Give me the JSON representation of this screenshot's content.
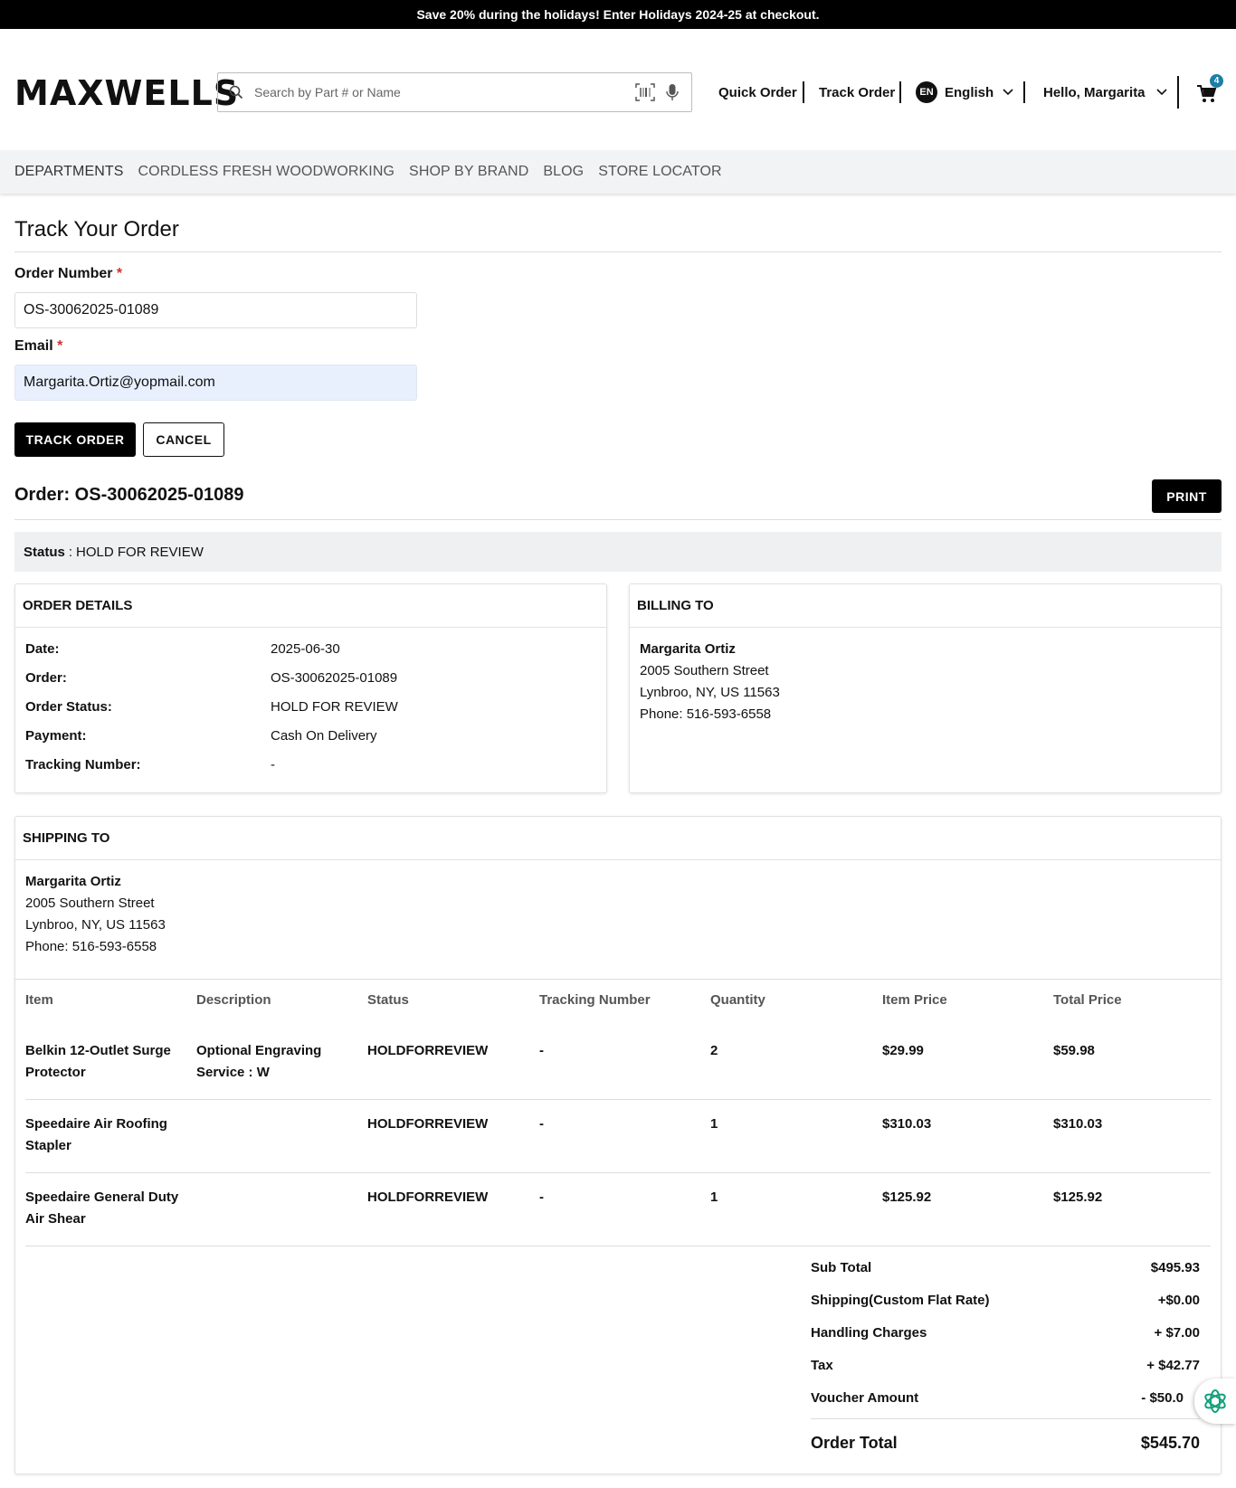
{
  "promo": {
    "text": "Save 20% during the holidays! Enter Holidays 2024-25 at checkout."
  },
  "header": {
    "logo": "MAXWELLS",
    "search_placeholder": "Search by Part # or Name",
    "quick_order": "Quick Order",
    "track_order": "Track Order",
    "lang_code": "EN",
    "language": "English",
    "greeting": "Hello, Margarita",
    "cart_count": "4",
    "cart_badge_color": "#1a7fa6"
  },
  "catnav": {
    "items": [
      "DEPARTMENTS",
      "CORDLESS FRESH WOODWORKING",
      "SHOP BY BRAND",
      "BLOG",
      "STORE LOCATOR"
    ]
  },
  "form": {
    "title": "Track Your Order",
    "order_label": "Order Number",
    "order_value": "OS-30062025-01089",
    "email_label": "Email",
    "email_value": "Margarita.Ortiz@yopmail.com",
    "required_mark": "*",
    "track_button": "TRACK ORDER",
    "cancel_button": "CANCEL"
  },
  "order": {
    "heading": "Order: OS-30062025-01089",
    "print_button": "PRINT",
    "status_label": "Status",
    "status_value": "HOLD FOR REVIEW"
  },
  "order_details": {
    "title": "ORDER DETAILS",
    "rows": [
      {
        "k": "Date:",
        "v": "2025-06-30"
      },
      {
        "k": "Order:",
        "v": "OS-30062025-01089"
      },
      {
        "k": "Order Status:",
        "v": "HOLD FOR REVIEW"
      },
      {
        "k": "Payment:",
        "v": "Cash On Delivery"
      },
      {
        "k": "Tracking Number:",
        "v": "-"
      }
    ]
  },
  "billing": {
    "title": "BILLING TO",
    "name": "Margarita Ortiz",
    "street": "2005 Southern Street",
    "city": "Lynbroo, NY, US 11563",
    "phone": "Phone: 516-593-6558"
  },
  "shipping": {
    "title": "SHIPPING TO",
    "name": "Margarita Ortiz",
    "street": "2005 Southern Street",
    "city": "Lynbroo, NY, US 11563",
    "phone": "Phone: 516-593-6558"
  },
  "items_table": {
    "headers": [
      "Item",
      "Description",
      "Status",
      "Tracking Number",
      "Quantity",
      "Item Price",
      "Total Price"
    ],
    "rows": [
      {
        "item_l1": "Belkin 12-Outlet Surge",
        "item_l2": "Protector",
        "desc_l1": "Optional Engraving",
        "desc_l2": "Service : W",
        "status": "HOLDFORREVIEW",
        "tracking": "-",
        "qty": "2",
        "price": "$29.99",
        "total": "$59.98"
      },
      {
        "item_l1": "Speedaire Air Roofing",
        "item_l2": "Stapler",
        "desc_l1": "",
        "desc_l2": "",
        "status": "HOLDFORREVIEW",
        "tracking": "-",
        "qty": "1",
        "price": "$310.03",
        "total": "$310.03"
      },
      {
        "item_l1": "Speedaire General Duty",
        "item_l2": "Air Shear",
        "desc_l1": "",
        "desc_l2": "",
        "status": "HOLDFORREVIEW",
        "tracking": "-",
        "qty": "1",
        "price": "$125.92",
        "total": "$125.92"
      }
    ]
  },
  "totals": {
    "rows": [
      {
        "k": "Sub Total",
        "v": "$495.93"
      },
      {
        "k": "Shipping(Custom Flat Rate)",
        "v": "+$0.00"
      },
      {
        "k": "Handling Charges",
        "v": "+ $7.00"
      },
      {
        "k": "Tax",
        "v": "+ $42.77"
      },
      {
        "k": "Voucher Amount",
        "v": "- $50.0"
      }
    ],
    "grand_label": "Order Total",
    "grand_value": "$545.70"
  }
}
